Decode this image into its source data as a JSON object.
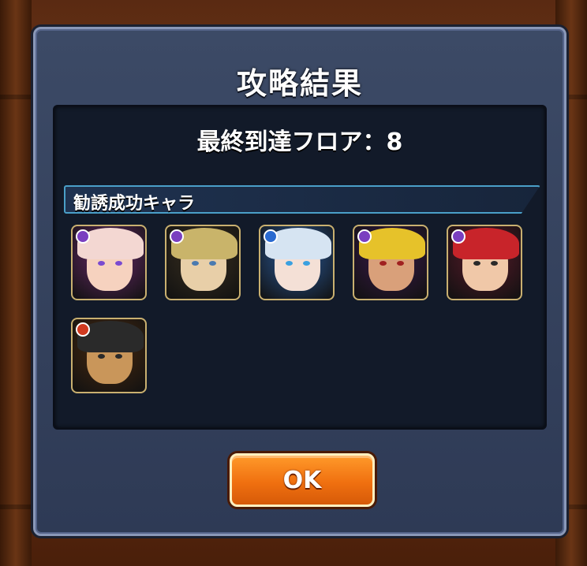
{
  "dialog": {
    "title": "攻略結果",
    "floor_text": "最終到達フロア：8",
    "section_label": "勧誘成功キャラ",
    "ok_label": "OK"
  },
  "characters": [
    {
      "name": "character-1",
      "element_color": "#7a3fc0",
      "hair": "#f3d7d2",
      "skin": "#f6d2bf",
      "bg": "#6a2a6a",
      "eye": "#7a4ad0"
    },
    {
      "name": "character-2",
      "element_color": "#7a3fc0",
      "hair": "#c9b46a",
      "skin": "#e8cfa8",
      "bg": "#3a3020",
      "eye": "#4a7ab0"
    },
    {
      "name": "character-3",
      "element_color": "#2a6ad0",
      "hair": "#d6e4f2",
      "skin": "#f4e0d6",
      "bg": "#2a5a9a",
      "eye": "#3aa0e0"
    },
    {
      "name": "character-4",
      "element_color": "#7a3fc0",
      "hair": "#e6c22a",
      "skin": "#d9a07a",
      "bg": "#3a1a4a",
      "eye": "#a02020"
    },
    {
      "name": "character-5",
      "element_color": "#7a3fc0",
      "hair": "#c8242a",
      "skin": "#f0c8a8",
      "bg": "#5a1a2a",
      "eye": "#2a2a2a"
    },
    {
      "name": "character-6",
      "element_color": "#d03a20",
      "hair": "#2a2a2a",
      "skin": "#c9965a",
      "bg": "#4a2a10",
      "eye": "#2a2a2a"
    }
  ]
}
